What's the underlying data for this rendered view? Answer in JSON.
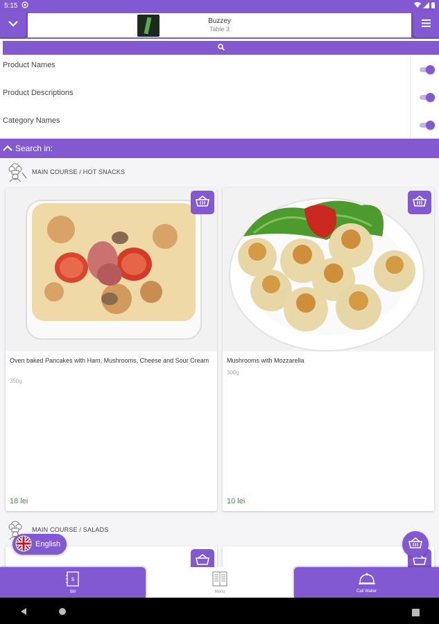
{
  "status_bar": {
    "time": "5:15"
  },
  "header": {
    "venue_name": "Buzzey",
    "table": "Table 3"
  },
  "filters": [
    {
      "label": "Product Names",
      "enabled": true
    },
    {
      "label": "Product Descriptions",
      "enabled": true
    },
    {
      "label": "Category Names",
      "enabled": true
    }
  ],
  "search_in_label": "Search in:",
  "categories": [
    {
      "title": "MAIN COURSE / HOT SNACKS",
      "products": [
        {
          "name": "Oven baked Pancakes with Ham, Mushrooms, Cheese and Sour Cream",
          "weight": "350g",
          "price": "18 lei"
        },
        {
          "name": "Mushrooms with Mozzarella",
          "weight": "300g",
          "price": "10 lei"
        }
      ]
    },
    {
      "title": "MAIN COURSE / SALADS"
    }
  ],
  "language": {
    "label": "English"
  },
  "bottom_nav": {
    "bill": "Bill",
    "menu": "Menu",
    "call_waiter": "Call Waiter"
  },
  "colors": {
    "accent": "#8259d1",
    "price": "#4a8a4a"
  },
  "icons": {
    "header_left": "chevron-down-icon",
    "header_right": "hamburger-menu-icon",
    "search": "search-icon",
    "basket": "basket-icon"
  }
}
